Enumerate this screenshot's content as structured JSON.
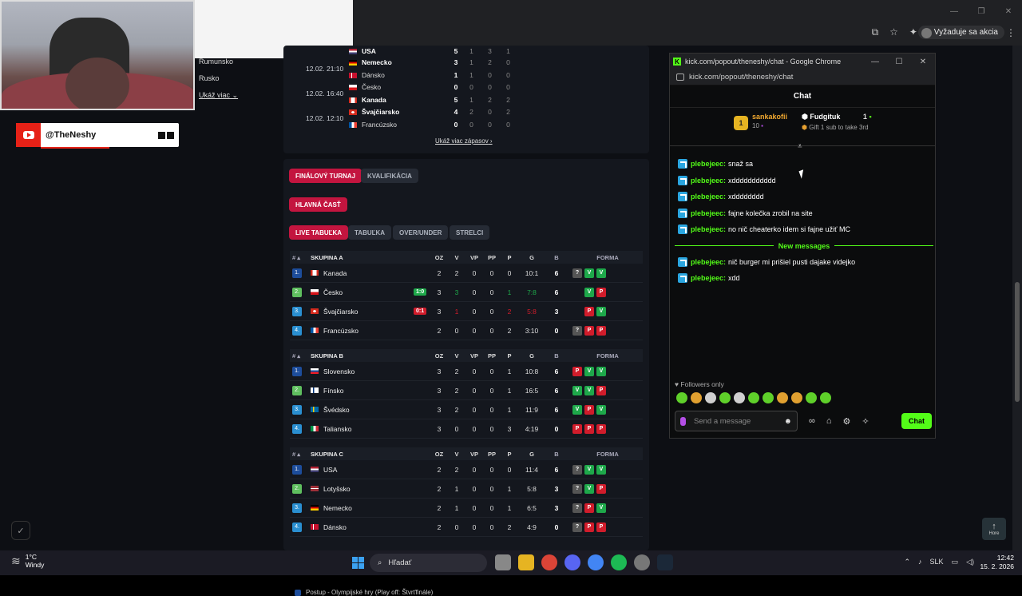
{
  "browser": {
    "update_label": "Vyžaduje sa akcia"
  },
  "sidebar": {
    "links": [
      "Rumunsko",
      "Rusko"
    ],
    "more": "Ukáž viac"
  },
  "overlay": {
    "channel": "@TheNeshy"
  },
  "matches": [
    {
      "date": "",
      "teams": [
        {
          "name": "USA",
          "bold": true,
          "score": "5",
          "a": "1",
          "b": "3",
          "c": "1",
          "flag": "us"
        }
      ]
    },
    {
      "date": "12.02. 21:10",
      "teams": [
        {
          "name": "Nemecko",
          "bold": true,
          "score": "3",
          "a": "1",
          "b": "2",
          "c": "0",
          "flag": "de"
        },
        {
          "name": "Dánsko",
          "bold": false,
          "score": "1",
          "a": "1",
          "b": "0",
          "c": "0",
          "flag": "dk"
        }
      ]
    },
    {
      "date": "12.02. 16:40",
      "teams": [
        {
          "name": "Česko",
          "bold": false,
          "score": "0",
          "a": "0",
          "b": "0",
          "c": "0",
          "flag": "cz"
        },
        {
          "name": "Kanada",
          "bold": true,
          "score": "5",
          "a": "1",
          "b": "2",
          "c": "2",
          "flag": "ca"
        }
      ]
    },
    {
      "date": "12.02. 12:10",
      "teams": [
        {
          "name": "Švajčiarsko",
          "bold": true,
          "score": "4",
          "a": "2",
          "b": "0",
          "c": "2",
          "flag": "ch"
        },
        {
          "name": "Francúzsko",
          "bold": false,
          "score": "0",
          "a": "0",
          "b": "0",
          "c": "0",
          "flag": "fr"
        }
      ]
    }
  ],
  "more_matches": "Ukáž viac zápasov",
  "tabs": {
    "final": "FINÁLOVÝ TURNAJ",
    "qual": "KVALIFIKÁCIA",
    "main": "HLAVNÁ ČASŤ",
    "live": "LIVE TABUĽKA",
    "table": "TABUĽKA",
    "ou": "OVER/UNDER",
    "scorers": "STRELCI"
  },
  "table_headers": {
    "rank": "# ▴",
    "oz": "OZ",
    "v": "V",
    "vp": "VP",
    "pp": "PP",
    "p": "P",
    "g": "G",
    "b": "B",
    "forma": "FORMA"
  },
  "groups": [
    {
      "name": "SKUPINA A",
      "rows": [
        {
          "rank": "1.",
          "team": "Kanada",
          "flag": "ca",
          "oz": "2",
          "v": "2",
          "vp": "0",
          "pp": "0",
          "p": "0",
          "g": "10:1",
          "b": "6",
          "form": [
            "Q",
            "V",
            "V"
          ],
          "live": "",
          "rc": "#1d4d9b"
        },
        {
          "rank": "2.",
          "team": "Česko",
          "flag": "cz",
          "oz": "3",
          "v": "3",
          "vp": "0",
          "pp": "0",
          "p": "1",
          "g": "7:8",
          "b": "6",
          "form": [
            "V",
            "P"
          ],
          "live": "1:0",
          "livec": "#1ea84a",
          "rc": "#5fbf5f"
        },
        {
          "rank": "3.",
          "team": "Švajčiarsko",
          "flag": "ch",
          "oz": "3",
          "v": "1",
          "vp": "0",
          "pp": "0",
          "p": "2",
          "g": "5:8",
          "b": "3",
          "form": [
            "P",
            "V"
          ],
          "live": "0:1",
          "livec": "#d11c2b",
          "rc": "#2a8fd1"
        },
        {
          "rank": "4.",
          "team": "Francúzsko",
          "flag": "fr",
          "oz": "2",
          "v": "0",
          "vp": "0",
          "pp": "0",
          "p": "2",
          "g": "3:10",
          "b": "0",
          "form": [
            "Q",
            "P",
            "P"
          ],
          "live": "",
          "rc": "#2a8fd1"
        }
      ]
    },
    {
      "name": "SKUPINA B",
      "rows": [
        {
          "rank": "1.",
          "team": "Slovensko",
          "flag": "sk",
          "oz": "3",
          "v": "2",
          "vp": "0",
          "pp": "0",
          "p": "1",
          "g": "10:8",
          "b": "6",
          "form": [
            "P",
            "V",
            "V"
          ],
          "live": "",
          "rc": "#1d4d9b"
        },
        {
          "rank": "2.",
          "team": "Fínsko",
          "flag": "fi",
          "oz": "3",
          "v": "2",
          "vp": "0",
          "pp": "0",
          "p": "1",
          "g": "16:5",
          "b": "6",
          "form": [
            "V",
            "V",
            "P"
          ],
          "live": "",
          "rc": "#5fbf5f"
        },
        {
          "rank": "3.",
          "team": "Švédsko",
          "flag": "se",
          "oz": "3",
          "v": "2",
          "vp": "0",
          "pp": "0",
          "p": "1",
          "g": "11:9",
          "b": "6",
          "form": [
            "V",
            "P",
            "V"
          ],
          "live": "",
          "rc": "#2a8fd1"
        },
        {
          "rank": "4.",
          "team": "Taliansko",
          "flag": "it",
          "oz": "3",
          "v": "0",
          "vp": "0",
          "pp": "0",
          "p": "3",
          "g": "4:19",
          "b": "0",
          "form": [
            "P",
            "P",
            "P"
          ],
          "live": "",
          "rc": "#2a8fd1"
        }
      ]
    },
    {
      "name": "SKUPINA C",
      "rows": [
        {
          "rank": "1.",
          "team": "USA",
          "flag": "us",
          "oz": "2",
          "v": "2",
          "vp": "0",
          "pp": "0",
          "p": "0",
          "g": "11:4",
          "b": "6",
          "form": [
            "Q",
            "V",
            "V"
          ],
          "live": "",
          "rc": "#1d4d9b"
        },
        {
          "rank": "2.",
          "team": "Lotyšsko",
          "flag": "lv",
          "oz": "2",
          "v": "1",
          "vp": "0",
          "pp": "0",
          "p": "1",
          "g": "5:8",
          "b": "3",
          "form": [
            "Q",
            "V",
            "P"
          ],
          "live": "",
          "rc": "#5fbf5f"
        },
        {
          "rank": "3.",
          "team": "Nemecko",
          "flag": "de",
          "oz": "2",
          "v": "1",
          "vp": "0",
          "pp": "0",
          "p": "1",
          "g": "6:5",
          "b": "3",
          "form": [
            "Q",
            "P",
            "V"
          ],
          "live": "",
          "rc": "#2a8fd1"
        },
        {
          "rank": "4.",
          "team": "Dánsko",
          "flag": "dk",
          "oz": "2",
          "v": "0",
          "vp": "0",
          "pp": "0",
          "p": "2",
          "g": "4:9",
          "b": "0",
          "form": [
            "Q",
            "P",
            "P"
          ],
          "live": "",
          "rc": "#2a8fd1"
        }
      ]
    }
  ],
  "legend_note": "Postup - Olympijské hry (Play off: Štvrťfinále)",
  "chat": {
    "window_title": "kick.com/popout/theneshy/chat - Google Chrome",
    "url": "kick.com/popout/theneshy/chat",
    "header": "Chat",
    "leader_rank": "1",
    "leader_name": "sankakofii",
    "leader_count": "10",
    "gifter_name": "Fudgituk",
    "gifter_count": "1",
    "gift_text": "Gift 1 sub to take 3rd",
    "messages_before": [
      {
        "user": "plebejeec:",
        "text": "snaž sa"
      },
      {
        "user": "plebejeec:",
        "text": "xddddddddddd"
      },
      {
        "user": "plebejeec:",
        "text": "xdddddddd"
      },
      {
        "user": "plebejeec:",
        "text": "fajne kolečka zrobil na site"
      },
      {
        "user": "plebejeec:",
        "text": "no nič cheaterko idem si fajne užiť MC"
      }
    ],
    "new_messages": "New messages",
    "messages_after": [
      {
        "user": "plebejeec:",
        "text": "nič burger mi prišiel pusti dajake videjko"
      },
      {
        "user": "plebejeec:",
        "text": "xdd"
      }
    ],
    "followers_only": "Followers only",
    "placeholder": "Send a message",
    "send": "Chat"
  },
  "home_label": "Hore",
  "taskbar": {
    "temp": "1°C",
    "weather": "Windy",
    "search": "Hľadať",
    "lang": "SLK",
    "time": "12:42",
    "date": "15. 2. 2026"
  }
}
